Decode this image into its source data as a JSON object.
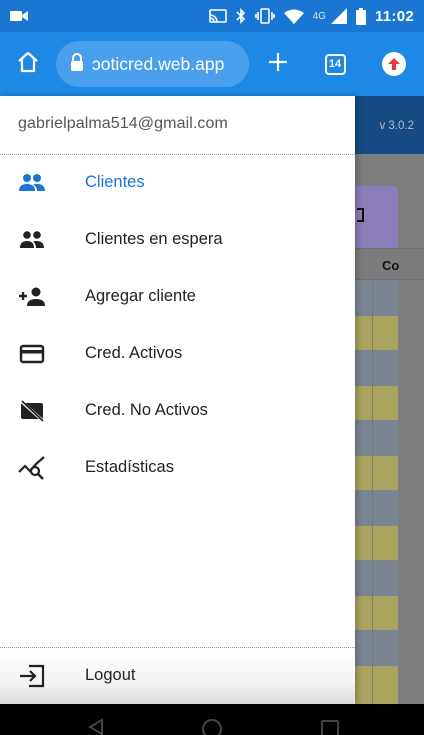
{
  "status_bar": {
    "network_type": "4G",
    "time": "11:02",
    "icons": [
      "video-camera-icon",
      "cast-icon",
      "bluetooth-icon",
      "vibrate-icon",
      "wifi-icon",
      "signal-icon",
      "battery-icon"
    ]
  },
  "browser": {
    "url": "ɔoticred.web.app",
    "tab_count": "14",
    "icons": [
      "home-icon",
      "lock-icon",
      "plus-icon",
      "tabs-icon",
      "update-arrow-icon"
    ]
  },
  "app": {
    "version": "v 3.0.2",
    "column_header_fragment": "Co"
  },
  "drawer": {
    "account_email": "gabrielpalma514@gmail.com",
    "items": [
      {
        "label": "Clientes",
        "icon": "people-icon",
        "active": true
      },
      {
        "label": "Clientes en espera",
        "icon": "people-waiting-icon",
        "active": false
      },
      {
        "label": "Agregar cliente",
        "icon": "person-add-icon",
        "active": false
      },
      {
        "label": "Cred. Activos",
        "icon": "credit-card-icon",
        "active": false
      },
      {
        "label": "Cred. No Activos",
        "icon": "credit-card-off-icon",
        "active": false
      },
      {
        "label": "Estadísticas",
        "icon": "query-stats-icon",
        "active": false
      }
    ],
    "logout_label": "Logout"
  },
  "colors": {
    "accent": "#1976d2",
    "browser_bar": "#1e88e5",
    "app_header": "#154a85"
  }
}
